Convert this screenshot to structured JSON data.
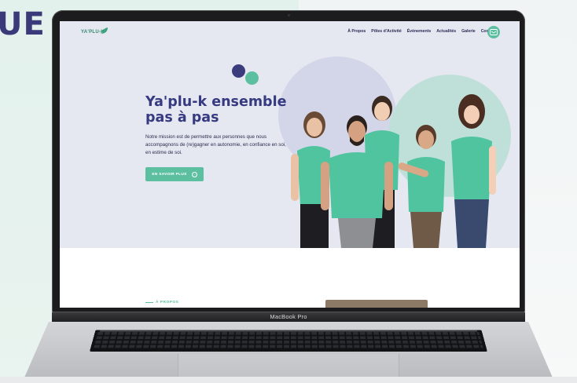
{
  "backdrop": {
    "word": "UE"
  },
  "laptop": {
    "model": "MacBook Pro"
  },
  "site": {
    "logo_text": "YA'PLU-K",
    "nav": {
      "items": [
        "À Propos",
        "Pôles d'Activité",
        "Évènements",
        "Actualités",
        "Galerie",
        "Contact"
      ],
      "contact_icon": "message-icon"
    },
    "hero": {
      "title": "Ya'plu-k ensemble pas à pas",
      "mission": "Notre mission est de permettre aux personnes que nous accompagnons de (re)gagner en autonomie, en confiance en soi, en estime de soi.",
      "cta_label": "EN SAVOIR PLUS",
      "cta_icon": "arrow-right-icon"
    },
    "section_label": "À PROPOS"
  },
  "colors": {
    "accent": "#5cbf9f",
    "navy": "#363a80",
    "hero_bg": "#e5e7f1"
  }
}
